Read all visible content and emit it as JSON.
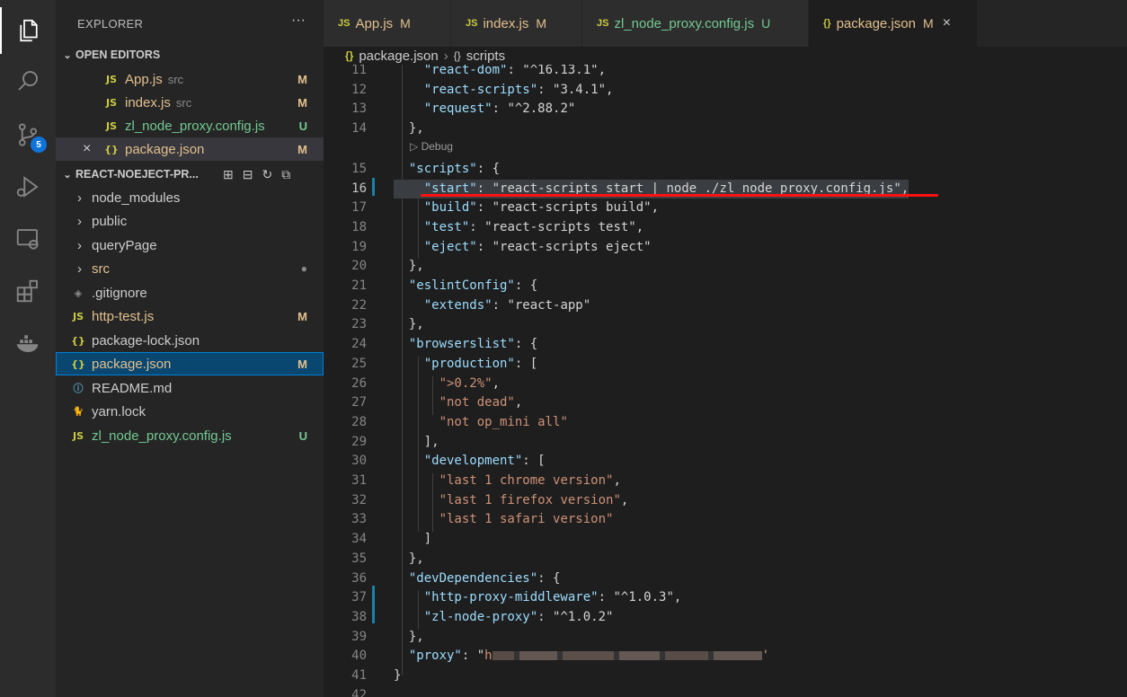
{
  "activity_bar": {
    "items": [
      {
        "name": "explorer-icon"
      },
      {
        "name": "search-icon"
      },
      {
        "name": "source-control-icon",
        "badge": "5"
      },
      {
        "name": "run-debug-icon"
      },
      {
        "name": "remote-explorer-icon"
      },
      {
        "name": "extensions-icon"
      },
      {
        "name": "docker-icon"
      }
    ]
  },
  "sidebar": {
    "title": "EXPLORER",
    "more": "···",
    "open_editors": {
      "header": "OPEN EDITORS",
      "items": [
        {
          "icon": "JS",
          "label": "App.js",
          "dir": "src",
          "status": "M"
        },
        {
          "icon": "JS",
          "label": "index.js",
          "dir": "src",
          "status": "M"
        },
        {
          "icon": "JS",
          "label": "zl_node_proxy.config.js",
          "dir": "",
          "status": "U"
        },
        {
          "icon": "{}",
          "label": "package.json",
          "dir": "",
          "status": "M",
          "close": "×"
        }
      ]
    },
    "project": {
      "header": "REACT-NOEJECT-PR...",
      "items": [
        {
          "chev": "›",
          "label": "node_modules",
          "status": ""
        },
        {
          "chev": "›",
          "label": "public",
          "status": ""
        },
        {
          "chev": "›",
          "label": "queryPage",
          "status": ""
        },
        {
          "chev": "›",
          "label": "src",
          "status": "●"
        },
        {
          "icon": "◈",
          "label": ".gitignore",
          "status": ""
        },
        {
          "icon": "JS",
          "label": "http-test.js",
          "status": "M"
        },
        {
          "icon": "{}",
          "label": "package-lock.json",
          "status": ""
        },
        {
          "icon": "{}",
          "label": "package.json",
          "status": "M"
        },
        {
          "icon": "ⓘ",
          "label": "README.md",
          "status": ""
        },
        {
          "icon": "🐈",
          "label": "yarn.lock",
          "status": ""
        },
        {
          "icon": "JS",
          "label": "zl_node_proxy.config.js",
          "status": "U"
        }
      ]
    }
  },
  "tabs": [
    {
      "icon": "JS",
      "label": "App.js",
      "badge": "M"
    },
    {
      "icon": "JS",
      "label": "index.js",
      "badge": "M"
    },
    {
      "icon": "JS",
      "label": "zl_node_proxy.config.js",
      "badge": "U"
    },
    {
      "icon": "{}",
      "label": "package.json",
      "badge": "M",
      "close": "×"
    }
  ],
  "breadcrumb": {
    "file_icon": "{}",
    "file": "package.json",
    "sep": "›",
    "symbol_icon": "{}",
    "symbol": "scripts"
  },
  "editor": {
    "codelens": "▷ Debug",
    "proxy_value_prefix": "h",
    "lines": [
      {
        "n": "11",
        "text": "    \"react-dom\": \"^16.13.1\","
      },
      {
        "n": "12",
        "text": "    \"react-scripts\": \"3.4.1\","
      },
      {
        "n": "13",
        "text": "    \"request\": \"^2.88.2\""
      },
      {
        "n": "14",
        "text": "  },"
      },
      {
        "n": "15",
        "text": "  \"scripts\": {"
      },
      {
        "n": "16",
        "text": "    \"start\": \"react-scripts start | node ./zl_node_proxy.config.js\","
      },
      {
        "n": "17",
        "text": "    \"build\": \"react-scripts build\","
      },
      {
        "n": "18",
        "text": "    \"test\": \"react-scripts test\","
      },
      {
        "n": "19",
        "text": "    \"eject\": \"react-scripts eject\""
      },
      {
        "n": "20",
        "text": "  },"
      },
      {
        "n": "21",
        "text": "  \"eslintConfig\": {"
      },
      {
        "n": "22",
        "text": "    \"extends\": \"react-app\""
      },
      {
        "n": "23",
        "text": "  },"
      },
      {
        "n": "24",
        "text": "  \"browserslist\": {"
      },
      {
        "n": "25",
        "text": "    \"production\": ["
      },
      {
        "n": "26",
        "text": "      \">0.2%\","
      },
      {
        "n": "27",
        "text": "      \"not dead\","
      },
      {
        "n": "28",
        "text": "      \"not op_mini all\""
      },
      {
        "n": "29",
        "text": "    ],"
      },
      {
        "n": "30",
        "text": "    \"development\": ["
      },
      {
        "n": "31",
        "text": "      \"last 1 chrome version\","
      },
      {
        "n": "32",
        "text": "      \"last 1 firefox version\","
      },
      {
        "n": "33",
        "text": "      \"last 1 safari version\""
      },
      {
        "n": "34",
        "text": "    ]"
      },
      {
        "n": "35",
        "text": "  },"
      },
      {
        "n": "36",
        "text": "  \"devDependencies\": {"
      },
      {
        "n": "37",
        "text": "    \"http-proxy-middleware\": \"^1.0.3\","
      },
      {
        "n": "38",
        "text": "    \"zl-node-proxy\": \"^1.0.2\""
      },
      {
        "n": "39",
        "text": "  },"
      },
      {
        "n": "40",
        "text": "  \"proxy\": \""
      },
      {
        "n": "41",
        "text": "}"
      },
      {
        "n": "42",
        "text": ""
      }
    ]
  }
}
